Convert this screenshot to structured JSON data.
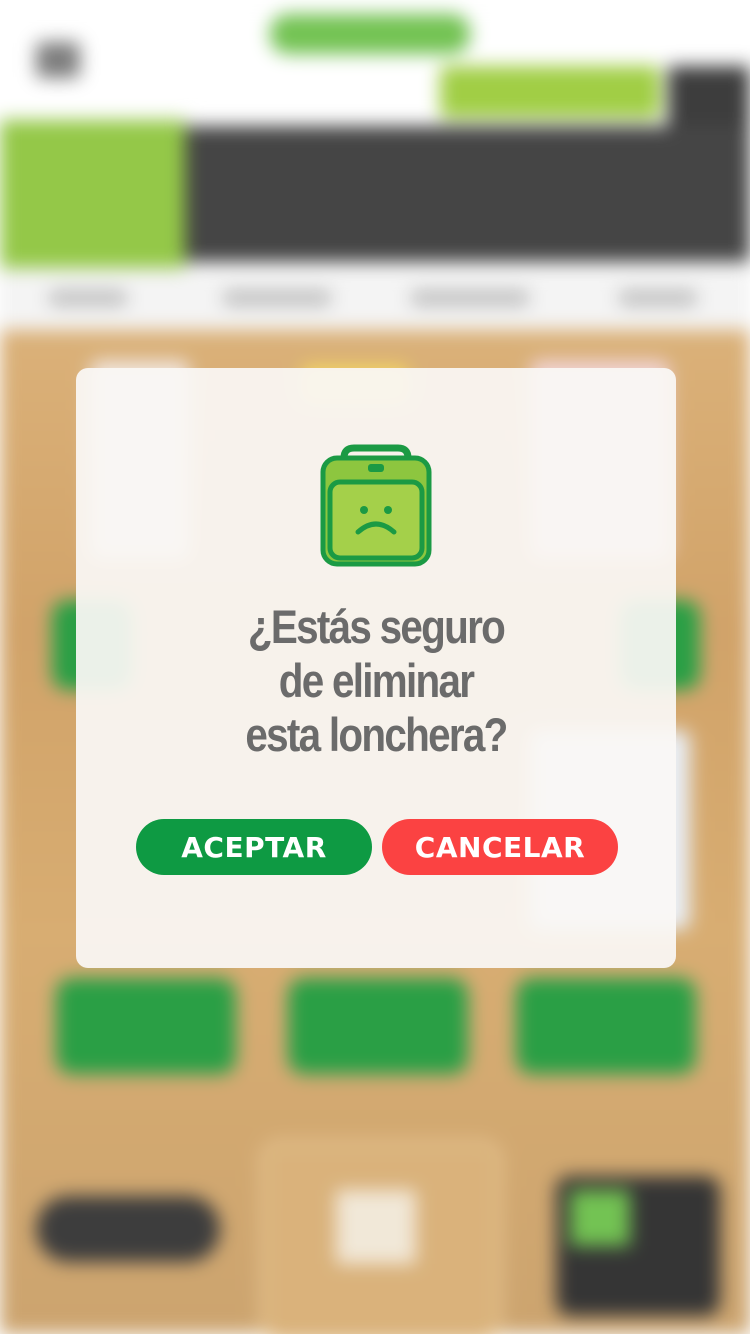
{
  "dialog": {
    "title_lines": [
      "¿Estás seguro",
      "de eliminar",
      "esta lonchera?"
    ],
    "accept_label": "ACEPTAR",
    "cancel_label": "CANCELAR",
    "icon": "sad-lunchbox-icon"
  },
  "colors": {
    "accept": "#0e9a43",
    "cancel": "#fb4242",
    "icon_green": "#8dc63f",
    "icon_outline": "#1b9a44",
    "title_text": "#6b6b6b"
  }
}
